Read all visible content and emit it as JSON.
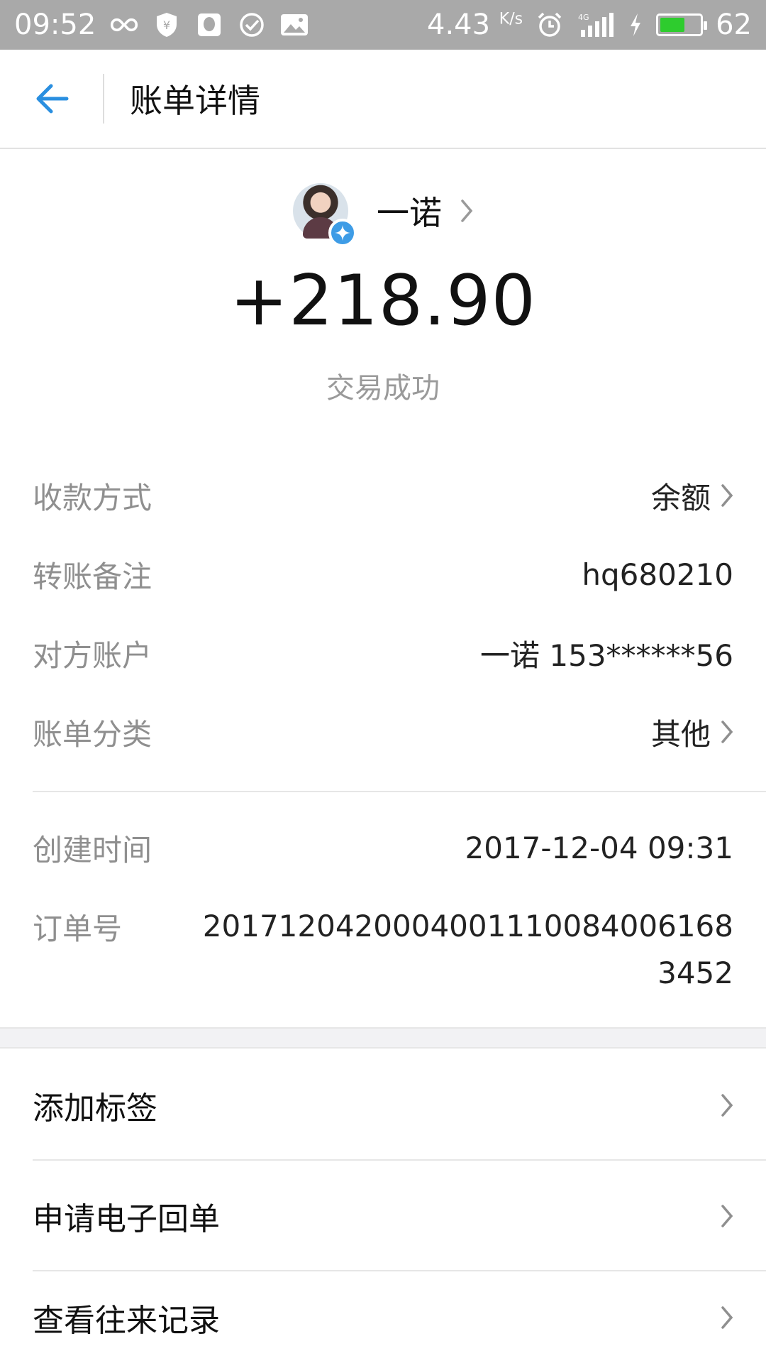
{
  "status_bar": {
    "time": "09:52",
    "speed": "4.43",
    "speed_unit": "K/s",
    "network": "4G",
    "battery": "62",
    "battery_level": 0.62
  },
  "header": {
    "title": "账单详情"
  },
  "summary": {
    "payee_name": "一诺",
    "amount": "+218.90",
    "status": "交易成功"
  },
  "details": [
    {
      "label": "收款方式",
      "value": "余额",
      "has_chevron": true
    },
    {
      "label": "转账备注",
      "value": "hq680210",
      "has_chevron": false
    },
    {
      "label": "对方账户",
      "value": "一诺 153******56",
      "has_chevron": false
    },
    {
      "label": "账单分类",
      "value": "其他",
      "has_chevron": true
    }
  ],
  "meta": [
    {
      "label": "创建时间",
      "value": "2017-12-04 09:31"
    },
    {
      "label": "订单号",
      "value": "2017120420004001110084006168345 2",
      "display": "20171204200040011100840061683452"
    }
  ],
  "actions": [
    {
      "label": "添加标签"
    },
    {
      "label": "申请电子回单"
    },
    {
      "label": "查看往来记录"
    }
  ],
  "colors": {
    "accent": "#2a8fe0",
    "status_bar_bg": "#a9a9a9",
    "label_gray": "#8f8f8f",
    "badge_blue": "#3e9ce6",
    "battery_green": "#2ecc2e"
  }
}
